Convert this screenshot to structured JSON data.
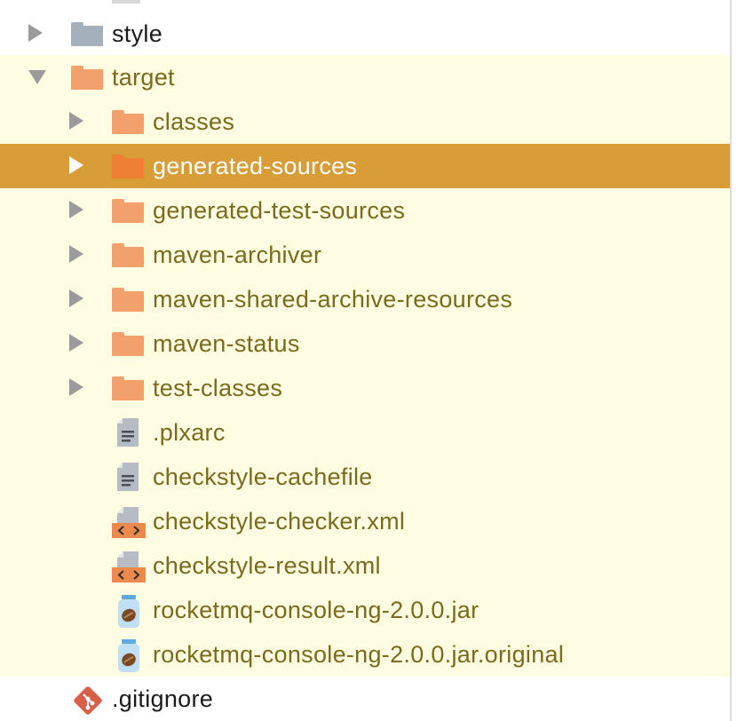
{
  "tree": {
    "items": [
      {
        "label": "style",
        "kind": "folder",
        "icon": "folder-icon",
        "color": "#a4b0bc",
        "expanded": false
      },
      {
        "label": "target",
        "kind": "folder",
        "icon": "folder-icon",
        "color": "#f2a16d",
        "expanded": true
      },
      {
        "label": "classes",
        "kind": "folder",
        "icon": "folder-icon",
        "expanded": false
      },
      {
        "label": "generated-sources",
        "kind": "folder",
        "icon": "folder-icon",
        "expanded": false,
        "selected": true
      },
      {
        "label": "generated-test-sources",
        "kind": "folder",
        "icon": "folder-icon",
        "expanded": false
      },
      {
        "label": "maven-archiver",
        "kind": "folder",
        "icon": "folder-icon",
        "expanded": false
      },
      {
        "label": "maven-shared-archive-resources",
        "kind": "folder",
        "icon": "folder-icon",
        "expanded": false
      },
      {
        "label": "maven-status",
        "kind": "folder",
        "icon": "folder-icon",
        "expanded": false
      },
      {
        "label": "test-classes",
        "kind": "folder",
        "icon": "folder-icon",
        "expanded": false
      },
      {
        "label": ".plxarc",
        "kind": "file",
        "icon": "text-file-icon"
      },
      {
        "label": "checkstyle-cachefile",
        "kind": "file",
        "icon": "text-file-icon"
      },
      {
        "label": "checkstyle-checker.xml",
        "kind": "file",
        "icon": "xml-file-icon"
      },
      {
        "label": "checkstyle-result.xml",
        "kind": "file",
        "icon": "xml-file-icon"
      },
      {
        "label": "rocketmq-console-ng-2.0.0.jar",
        "kind": "file",
        "icon": "jar-file-icon"
      },
      {
        "label": "rocketmq-console-ng-2.0.0.jar.original",
        "kind": "file",
        "icon": "jar-file-icon"
      },
      {
        "label": ".gitignore",
        "kind": "file",
        "icon": "git-file-icon"
      }
    ]
  },
  "colors": {
    "selection": "#d89d37",
    "ignored_highlight": "#fefde2",
    "ignored_text": "#7a6a1c",
    "git_icon": "#d95f49"
  }
}
